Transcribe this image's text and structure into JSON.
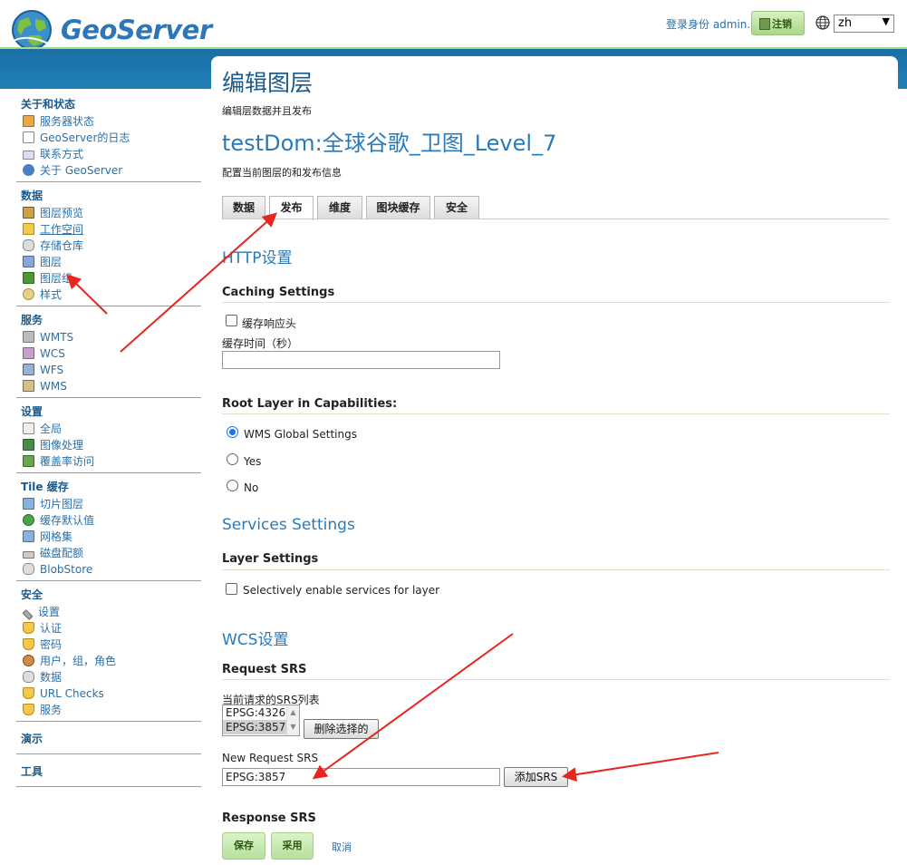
{
  "header": {
    "app_name": "GeoServer",
    "login_text": "登录身份 admin.",
    "logout_label": "注销",
    "language": "zh"
  },
  "sidebar": {
    "sections": [
      {
        "title": "关于和状态",
        "items": [
          {
            "label": "服务器状态",
            "icon": "server-status-icon"
          },
          {
            "label": "GeoServer的日志",
            "icon": "log-icon"
          },
          {
            "label": "联系方式",
            "icon": "contact-icon"
          },
          {
            "label": "关于 GeoServer",
            "icon": "about-icon"
          }
        ]
      },
      {
        "title": "数据",
        "items": [
          {
            "label": "图层预览",
            "icon": "layer-preview-icon"
          },
          {
            "label": "工作空间",
            "icon": "folder-icon"
          },
          {
            "label": "存储仓库",
            "icon": "store-icon"
          },
          {
            "label": "图层",
            "icon": "layer-icon"
          },
          {
            "label": "图层组",
            "icon": "layer-group-icon"
          },
          {
            "label": "样式",
            "icon": "style-icon"
          }
        ]
      },
      {
        "title": "服务",
        "items": [
          {
            "label": "WMTS",
            "icon": "wmts-icon"
          },
          {
            "label": "WCS",
            "icon": "wcs-icon"
          },
          {
            "label": "WFS",
            "icon": "wfs-icon"
          },
          {
            "label": "WMS",
            "icon": "wms-icon"
          }
        ]
      },
      {
        "title": "设置",
        "items": [
          {
            "label": "全局",
            "icon": "global-icon"
          },
          {
            "label": "图像处理",
            "icon": "image-processing-icon"
          },
          {
            "label": "覆盖率访问",
            "icon": "coverage-access-icon"
          }
        ]
      },
      {
        "title": "Tile 缓存",
        "items": [
          {
            "label": "切片图层",
            "icon": "tile-layers-icon"
          },
          {
            "label": "缓存默认值",
            "icon": "cache-defaults-icon"
          },
          {
            "label": "网格集",
            "icon": "gridset-icon"
          },
          {
            "label": "磁盘配额",
            "icon": "disk-quota-icon"
          },
          {
            "label": "BlobStore",
            "icon": "blobstore-icon"
          }
        ]
      },
      {
        "title": "安全",
        "items": [
          {
            "label": "设置",
            "icon": "wrench-icon"
          },
          {
            "label": "认证",
            "icon": "shield-icon"
          },
          {
            "label": "密码",
            "icon": "password-icon"
          },
          {
            "label": "用户，组，角色",
            "icon": "users-icon"
          },
          {
            "label": "数据",
            "icon": "data-security-icon"
          },
          {
            "label": "URL Checks",
            "icon": "url-check-icon"
          },
          {
            "label": "服务",
            "icon": "service-security-icon"
          }
        ]
      }
    ],
    "demo_title": "演示",
    "tools_title": "工具"
  },
  "main": {
    "page_title": "编辑图层",
    "page_subtitle": "编辑层数据并且发布",
    "layer_name": "testDom:全球谷歌_卫图_Level_7",
    "layer_subtitle": "配置当前图层的和发布信息",
    "tabs": [
      "数据",
      "发布",
      "维度",
      "图块缓存",
      "安全"
    ],
    "active_tab": "发布",
    "http_section": "HTTP设置",
    "caching_title": "Caching Settings",
    "cache_headers_label": "缓存响应头",
    "cache_time_label": "缓存时间（秒）",
    "cache_time_value": "",
    "root_layer_title": "Root Layer in Capabilities:",
    "root_options": [
      "WMS Global Settings",
      "Yes",
      "No"
    ],
    "root_selected": "WMS Global Settings",
    "services_section": "Services Settings",
    "layer_settings_title": "Layer Settings",
    "selectively_label": "Selectively enable services for layer",
    "wcs_section": "WCS设置",
    "request_srs_title": "Request SRS",
    "srs_list_label": "当前请求的SRS列表",
    "srs_list": [
      "EPSG:4326",
      "EPSG:3857"
    ],
    "srs_selected": "EPSG:3857",
    "remove_selected_label": "删除选择的",
    "new_srs_label": "New Request SRS",
    "new_srs_value": "EPSG:3857",
    "add_srs_label": "添加SRS",
    "response_srs_title": "Response SRS",
    "save_label": "保存",
    "apply_label": "采用",
    "cancel_label": "取消"
  },
  "colors": {
    "brand_blue": "#2a7ab8",
    "band_blue": "#1a6fa3",
    "green_button": "#b6e09a",
    "annotation_red": "#e8251f"
  }
}
